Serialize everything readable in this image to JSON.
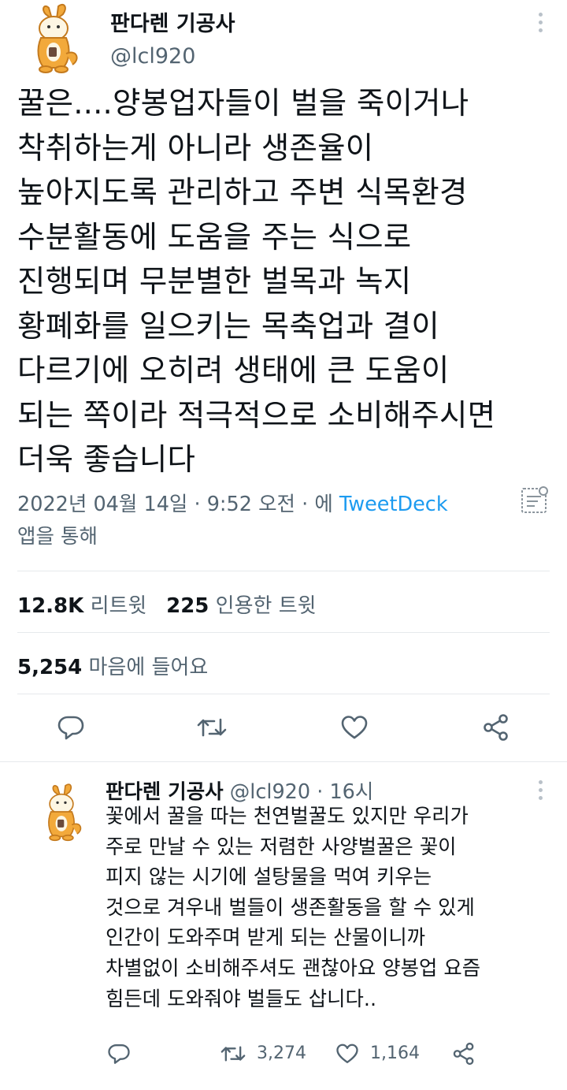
{
  "main_tweet": {
    "author_name": "판다렌 기공사",
    "author_handle": "@lcl920",
    "text": "꿀은....양봉업자들이 벌을 죽이거나\n착취하는게 아니라 생존율이\n높아지도록 관리하고 주변 식목환경\n수분활동에 도움을 주는 식으로\n진행되며 무분별한 벌목과 녹지\n황폐화를 일으키는 목축업과 결이\n다르기에 오히려 생태에 큰 도움이\n되는 쪽이라 적극적으로 소비해주시면\n더욱 좋습니다",
    "timestamp": "2022년 04월 14일 · 9:52 오전 · ",
    "via_prefix": "에 ",
    "client": "TweetDeck",
    "via_suffix": "앱을 통해",
    "stats": {
      "retweets_count": "12.8K",
      "retweets_label": "리트윗",
      "quotes_count": "225",
      "quotes_label": "인용한 트윗",
      "likes_count": "5,254",
      "likes_label": "마음에 들어요"
    },
    "icons": [
      "reply-icon",
      "retweet-icon",
      "like-icon",
      "share-icon",
      "analytics-icon",
      "more-icon"
    ]
  },
  "reply_tweet": {
    "author_name": "판다렌 기공사",
    "author_handle": "@lcl920",
    "time": "· 16시",
    "text": "꽃에서 꿀을 따는 천연벌꿀도 있지만 우리가\n주로 만날 수 있는 저렴한 사양벌꿀은 꽃이\n피지 않는 시기에 설탕물을 먹여 키우는\n것으로 겨우내 벌들이 생존활동을 할 수 있게\n인간이 도와주며 받게 되는 산물이니까\n차별없이 소비해주셔도 괜찮아요 양봉업 요즘\n힘든데 도와줘야 벌들도 삽니다..",
    "retweet_count": "3,274",
    "like_count": "1,164"
  },
  "colors": {
    "text": "#0f1419",
    "secondary": "#536471",
    "link": "#1d9bf0",
    "divider": "#e6e9ec",
    "avatar_orange": "#f2a93b",
    "avatar_cream": "#fdf6e4"
  }
}
